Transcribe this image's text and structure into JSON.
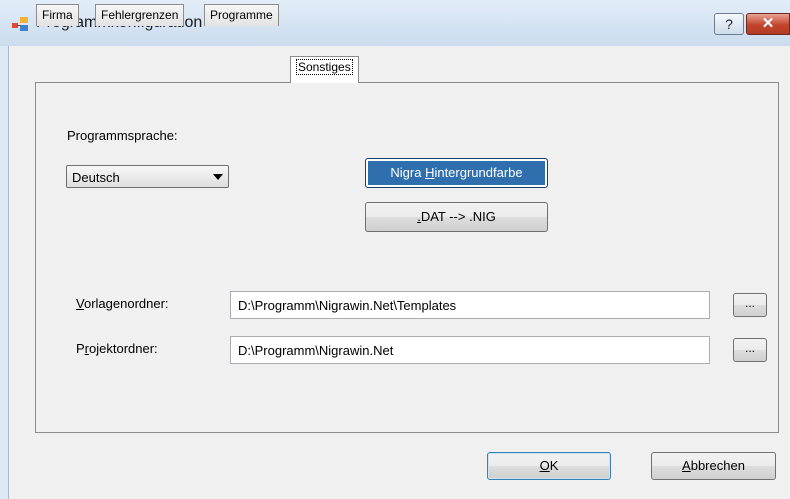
{
  "window": {
    "title": "Programmkonfiguration",
    "help_label": "?",
    "close_label": "✕"
  },
  "tabs": [
    {
      "label": "Firma",
      "active": false
    },
    {
      "label": "Fehlergrenzen",
      "active": false
    },
    {
      "label": "Programme",
      "active": false
    },
    {
      "label": "Sonstiges",
      "active": true
    }
  ],
  "sonstiges": {
    "language_label": "Programmsprache:",
    "language_value": "Deutsch",
    "color_button": {
      "pre": "Nigra ",
      "mnemonic": "H",
      "post": "intergrundfarbe"
    },
    "dat_button": {
      "pre": "",
      "mnemonic": ".",
      "post": "DAT --> .NIG"
    },
    "template_label": {
      "mnemonic": "V",
      "post": "orlagenordner:"
    },
    "template_value": "D:\\Programm\\Nigrawin.Net\\Templates",
    "template_browse": "...",
    "project_label": {
      "pre": "P",
      "mnemonic": "r",
      "post": "ojektordner:"
    },
    "project_value": "D:\\Programm\\Nigrawin.Net",
    "project_browse": "..."
  },
  "footer": {
    "ok": {
      "mnemonic": "O",
      "post": "K"
    },
    "cancel": {
      "mnemonic": "A",
      "post": "bbrechen"
    }
  },
  "colors": {
    "highlight_button": "#2f6fad",
    "close_button": "#c2452f"
  }
}
